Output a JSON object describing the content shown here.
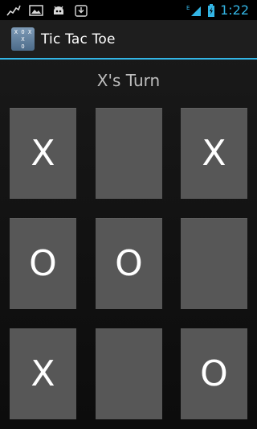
{
  "status_bar": {
    "time": "1:22",
    "network_type": "E",
    "icons": [
      "activity-chart-icon",
      "image-icon",
      "android-icon",
      "download-icon",
      "signal-icon",
      "battery-icon"
    ]
  },
  "app": {
    "title": "Tic Tac Toe",
    "icon_name": "tic-tac-toe-app-icon",
    "icon_grid": [
      "X",
      "O",
      "X",
      "",
      "X",
      "",
      "",
      "O",
      ""
    ]
  },
  "game": {
    "turn_label": "X's Turn",
    "cells": [
      "X",
      "",
      "X",
      "O",
      "O",
      "",
      "X",
      "",
      "O"
    ]
  },
  "colors": {
    "accent": "#33b5e5",
    "cell": "#575757"
  }
}
